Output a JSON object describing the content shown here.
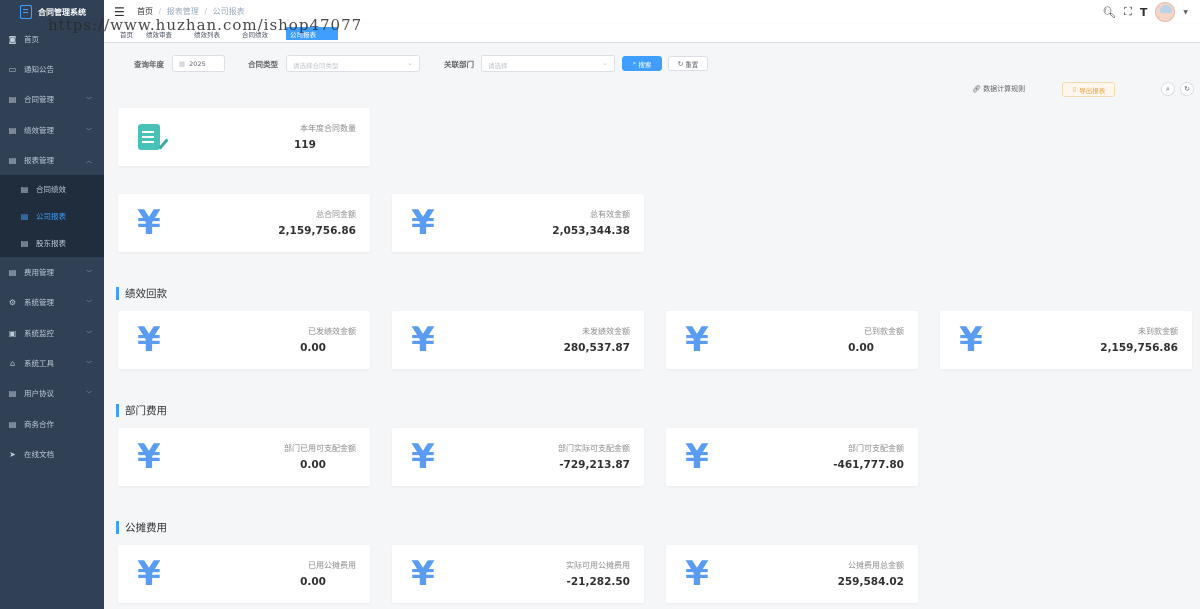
{
  "app": {
    "title": "合同管理系统",
    "watermark": "https://www.huzhan.com/ishop47077"
  },
  "sidebar": {
    "items": [
      {
        "label": "首页",
        "icon": "dashboard-icon"
      },
      {
        "label": "通知公告",
        "icon": "message-icon"
      },
      {
        "label": "合同管理",
        "icon": "document-icon",
        "expandable": true
      },
      {
        "label": "绩效管理",
        "icon": "document-icon",
        "expandable": true
      },
      {
        "label": "报表管理",
        "icon": "document-icon",
        "expandable": true,
        "expanded": true
      },
      {
        "label": "合同绩效",
        "icon": "document-icon",
        "sub": true
      },
      {
        "label": "公司报表",
        "icon": "document-icon",
        "sub": true,
        "active": true
      },
      {
        "label": "股东报表",
        "icon": "document-icon",
        "sub": true
      },
      {
        "label": "费用管理",
        "icon": "document-icon",
        "expandable": true
      },
      {
        "label": "系统管理",
        "icon": "system-icon",
        "expandable": true
      },
      {
        "label": "系统监控",
        "icon": "monitor-icon",
        "expandable": true
      },
      {
        "label": "系统工具",
        "icon": "tool-icon",
        "expandable": true
      },
      {
        "label": "用户协议",
        "icon": "document-icon",
        "expandable": true
      },
      {
        "label": "商务合作",
        "icon": "document-icon"
      },
      {
        "label": "在线文档",
        "icon": "send-icon"
      }
    ]
  },
  "navbar": {
    "breadcrumb": [
      "首页",
      "报表管理",
      "公司报表"
    ]
  },
  "tags": [
    {
      "label": "首页"
    },
    {
      "label": "绩效审查"
    },
    {
      "label": "绩效列表"
    },
    {
      "label": "合同绩效"
    },
    {
      "label": "公司报表",
      "active": true
    }
  ],
  "filters": {
    "year_label": "查询年度",
    "year_value": "2025",
    "type_label": "合同类型",
    "type_placeholder": "请选择合同类型",
    "dept_label": "关联部门",
    "dept_placeholder": "请选择",
    "search_button": "搜索",
    "reset_button": "重置"
  },
  "toolbar": {
    "rules_link": "数据计算规则",
    "export_button": "导出报表"
  },
  "stats": {
    "contract_count": {
      "title": "本年度合同数量",
      "value": "119"
    },
    "total_amount": {
      "title": "总合同金额",
      "value": "2,159,756.86"
    },
    "valid_amount": {
      "title": "总有效金额",
      "value": "2,053,344.38"
    }
  },
  "sections": {
    "performance": {
      "title": "绩效回款",
      "cards": [
        {
          "title": "已发绩效金额",
          "value": "0.00"
        },
        {
          "title": "未发绩效金额",
          "value": "280,537.87"
        },
        {
          "title": "已到款金额",
          "value": "0.00"
        },
        {
          "title": "未到款金额",
          "value": "2,159,756.86"
        }
      ]
    },
    "dept": {
      "title": "部门费用",
      "cards": [
        {
          "title": "部门已用可支配金额",
          "value": "0.00"
        },
        {
          "title": "部门实际可支配金额",
          "value": "-729,213.87"
        },
        {
          "title": "部门可支配金额",
          "value": "-461,777.80"
        }
      ]
    },
    "shared": {
      "title": "公摊费用",
      "cards": [
        {
          "title": "已用公摊费用",
          "value": "0.00"
        },
        {
          "title": "实际可用公摊费用",
          "value": "-21,282.50"
        },
        {
          "title": "公摊费用总金额",
          "value": "259,584.02"
        }
      ]
    }
  },
  "colors": {
    "sidebar_bg": "#304156",
    "accent": "#409eff",
    "yen_icon": "#5a9cf2",
    "doc_icon": "#48c1b8"
  }
}
